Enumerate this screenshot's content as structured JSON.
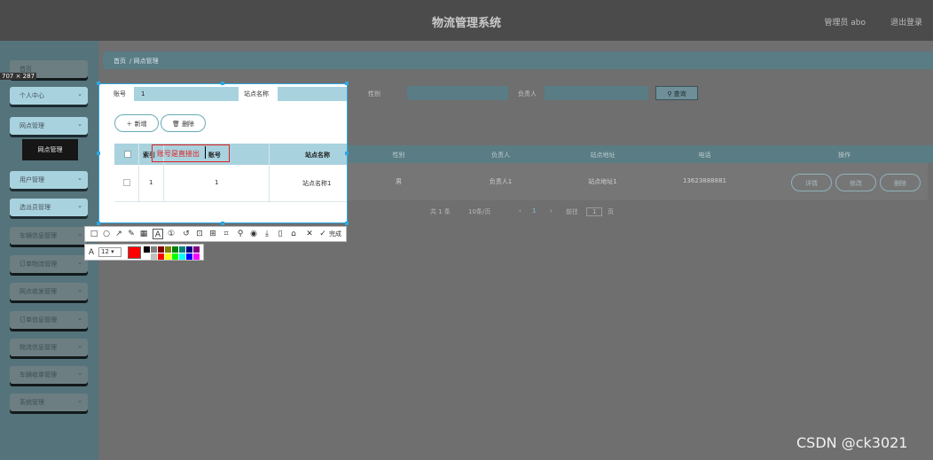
{
  "header": {
    "title": "物流管理系统",
    "admin": "管理员 abo",
    "logout": "退出登录"
  },
  "sidebar": {
    "items": [
      {
        "label": "首页"
      },
      {
        "label": "个人中心"
      },
      {
        "label": "网点管理"
      },
      {
        "label": "用户管理"
      },
      {
        "label": "选派员管理"
      },
      {
        "label": "车辆信息管理"
      },
      {
        "label": "订单物流管理"
      },
      {
        "label": "网点收发管理"
      },
      {
        "label": "订单信息管理"
      },
      {
        "label": "物流信息管理"
      },
      {
        "label": "车辆收单管理"
      },
      {
        "label": "系统管理"
      }
    ],
    "submenu": "网点管理"
  },
  "breadcrumb": [
    "首页",
    "网点管理"
  ],
  "search": {
    "account_label": "账号",
    "account_value": "1",
    "station_label": "站点名称",
    "gender_label": "性别",
    "owner_label": "负责人",
    "search_button": "查询"
  },
  "actions": {
    "add": "新增",
    "delete": "删除"
  },
  "table": {
    "headers": [
      "账号",
      "站点名称",
      "性别",
      "负责人",
      "站点地址",
      "电话",
      "操作"
    ],
    "row": {
      "index": "1",
      "account": "1",
      "station": "站点名称1",
      "gender": "男",
      "owner": "负责人1",
      "address": "站点地址1",
      "phone": "13623888881"
    },
    "ops": [
      "详情",
      "修改",
      "删除"
    ]
  },
  "pagination": {
    "total": "共 1 条",
    "per_page": "10条/页",
    "current": "1",
    "goto_label": "前往",
    "goto_value": "1",
    "page_unit": "页"
  },
  "overlay": {
    "size_label": "707 × 287",
    "annotation": "账号是直接出",
    "index_header": "索引",
    "done_label": "完成",
    "font_size": "12",
    "current_color": "#ff0000",
    "palette": [
      "#000000",
      "#808080",
      "#800000",
      "#808000",
      "#008000",
      "#008080",
      "#000080",
      "#800080",
      "#ffffff",
      "#c0c0c0",
      "#ff0000",
      "#ffff00",
      "#00ff00",
      "#00ffff",
      "#0000ff",
      "#ff00ff"
    ]
  },
  "watermark": "CSDN @ck3021"
}
